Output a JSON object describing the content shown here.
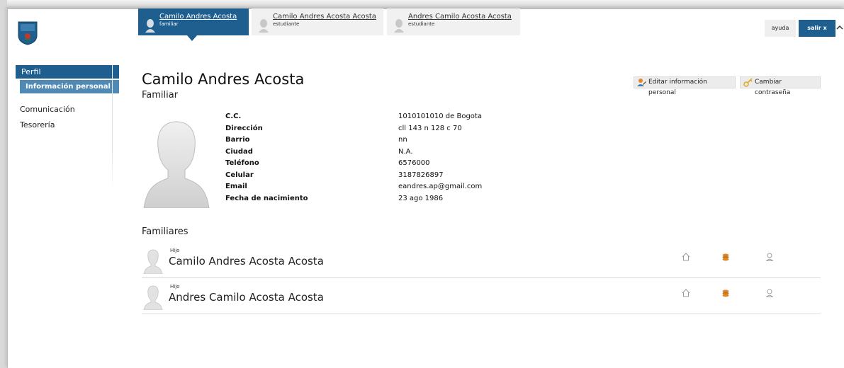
{
  "tabs": [
    {
      "name": "Camilo Andres Acosta",
      "role": "familiar",
      "active": true
    },
    {
      "name": "Camilo Andres Acosta Acosta",
      "role": "estudiante",
      "active": false
    },
    {
      "name": "Andres Camilo Acosta Acosta",
      "role": "estudiante",
      "active": false
    }
  ],
  "topbar": {
    "help_label": "ayuda",
    "logout_label": "salir x"
  },
  "sidebar": {
    "section": "Perfil",
    "sub_item": "Información personal",
    "items": [
      "Comunicación",
      "Tesorería"
    ]
  },
  "profile": {
    "name": "Camilo Andres Acosta",
    "role": "Familiar",
    "edit_label": "Editar información personal",
    "password_label": "Cambiar contraseña",
    "fields": [
      {
        "label": "C.C.",
        "value": "1010101010 de Bogota"
      },
      {
        "label": "Dirección",
        "value": "cll 143 n 128 c 70"
      },
      {
        "label": "Barrio",
        "value": "nn"
      },
      {
        "label": "Ciudad",
        "value": "N.A."
      },
      {
        "label": "Teléfono",
        "value": "6576000"
      },
      {
        "label": "Celular",
        "value": "3187826897"
      },
      {
        "label": "Email",
        "value": "eandres.ap@gmail.com"
      },
      {
        "label": "Fecha de nacimiento",
        "value": "23 ago 1986"
      }
    ]
  },
  "familiares": {
    "title": "Familiares",
    "members": [
      {
        "relation": "Hijo",
        "name": "Camilo Andres Acosta Acosta"
      },
      {
        "relation": "Hijo",
        "name": "Andres Camilo Acosta Acosta"
      }
    ]
  },
  "colors": {
    "brand": "#1f5f8f",
    "brand_light": "#4f89b4",
    "action_icon": "#e0892a"
  },
  "icons": [
    "shield-logo-icon",
    "user-avatar-icon",
    "edit-user-icon",
    "key-icon",
    "home-icon",
    "coins-icon",
    "student-icon",
    "chevron-up-icon"
  ]
}
